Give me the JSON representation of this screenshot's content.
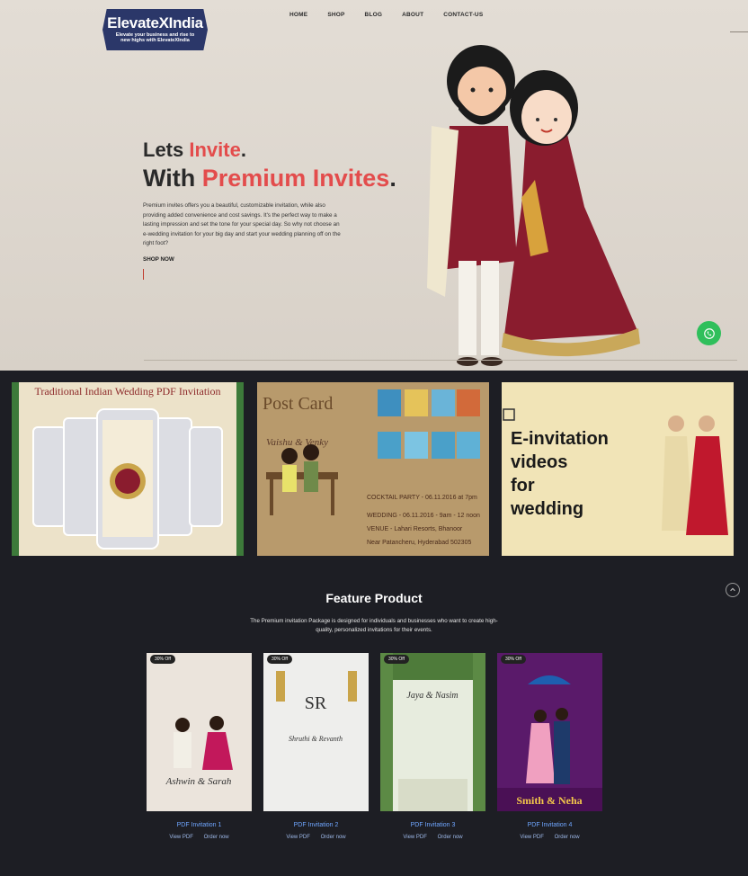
{
  "header": {
    "logo_brand": "ElevateXIndia",
    "logo_tagline": "Elevate your business and rise to new highs with ElevateXIndia",
    "nav": [
      "HOME",
      "SHOP",
      "BLOG",
      "ABOUT",
      "CONTACT-US"
    ]
  },
  "hero": {
    "line1_a": "Lets ",
    "line1_b": "Invite",
    "line1_c": ".",
    "line2_a": "With ",
    "line2_b": "Premium Invites",
    "line2_c": ".",
    "paragraph": "Premium invites offers you a beautiful, customizable invitation, while also providing added convenience and cost savings. It's the perfect way to make a lasting impression and set the tone for your special day. So why not choose an e-wedding invitation for your big day and start your wedding planning off on the right foot?",
    "cta": "SHOP NOW"
  },
  "banners": {
    "pdf_title": "Traditional Indian Wedding PDF Invitation",
    "postcard_title": "Post Card",
    "postcard_names": "Vaishu & Venky",
    "postcard_details": [
      "COCKTAIL PARTY - 06.11.2016 at 7pm",
      "WEDDING - 06.11.2016 - 9am - 12 noon",
      "VENUE - Lahari Resorts, Bhanoor",
      "Near Patancheru, Hyderabad 502305"
    ],
    "video_text": [
      "E-invitation",
      "videos",
      "for",
      "wedding"
    ]
  },
  "feature": {
    "title": "Feature Product",
    "description": "The Premium invitation Package is designed for individuals and businesses who want to create high-quality, personalized invitations for their events.",
    "products": [
      {
        "badge": "30% Off",
        "title": "PDF Invitation 1",
        "view": "View PDF",
        "order": "Order now",
        "names": "Ashwin & Sarah"
      },
      {
        "badge": "30% Off",
        "title": "PDF Invitation 2",
        "view": "View PDF",
        "order": "Order now",
        "names": "Shruthi & Revanth"
      },
      {
        "badge": "30% Off",
        "title": "PDF Invitation 3",
        "view": "View PDF",
        "order": "Order now",
        "names": "Jaya & Nasim"
      },
      {
        "badge": "30% Off",
        "title": "PDF Invitation 4",
        "view": "View PDF",
        "order": "Order now",
        "names": "Smith & Neha"
      }
    ]
  },
  "colors": {
    "accent": "#e34c4c",
    "dark_bg": "#1d1e24",
    "logo_bg": "#2b3769",
    "whatsapp": "#2fbf5b",
    "link": "#6fa6ff"
  },
  "icons": {
    "whatsapp": "whatsapp-icon",
    "scroll_top": "scroll-top-icon"
  }
}
